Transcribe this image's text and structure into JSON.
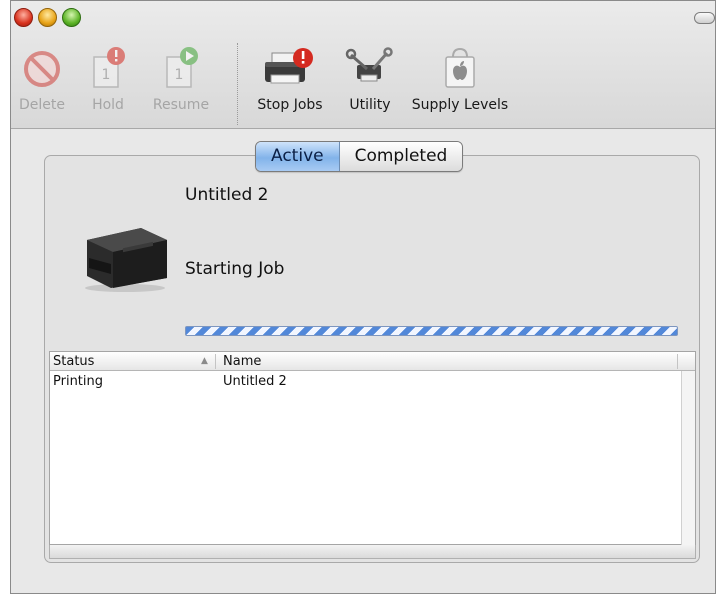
{
  "window": {
    "traffic_lights": [
      "close",
      "minimize",
      "zoom"
    ]
  },
  "toolbar": {
    "items": [
      {
        "label": "Delete",
        "icon": "delete-icon",
        "enabled": false
      },
      {
        "label": "Hold",
        "icon": "hold-icon",
        "enabled": false
      },
      {
        "label": "Resume",
        "icon": "resume-icon",
        "enabled": false
      },
      {
        "label": "Stop Jobs",
        "icon": "printer-stop-icon",
        "enabled": true
      },
      {
        "label": "Utility",
        "icon": "utility-icon",
        "enabled": true
      },
      {
        "label": "Supply Levels",
        "icon": "supply-levels-icon",
        "enabled": true
      }
    ]
  },
  "tabs": [
    {
      "label": "Active",
      "selected": true
    },
    {
      "label": "Completed",
      "selected": false
    }
  ],
  "current_job": {
    "title": "Untitled 2",
    "status": "Starting Job",
    "progress": "indeterminate"
  },
  "jobs_table": {
    "columns": [
      {
        "label": "Status",
        "sort": "ascending"
      },
      {
        "label": "Name"
      }
    ],
    "rows": [
      {
        "status": "Printing",
        "name": "Untitled 2"
      }
    ]
  },
  "colors": {
    "accent_blue": "#5288d9",
    "alert_red": "#d42a20",
    "resume_green": "#3fa535"
  }
}
